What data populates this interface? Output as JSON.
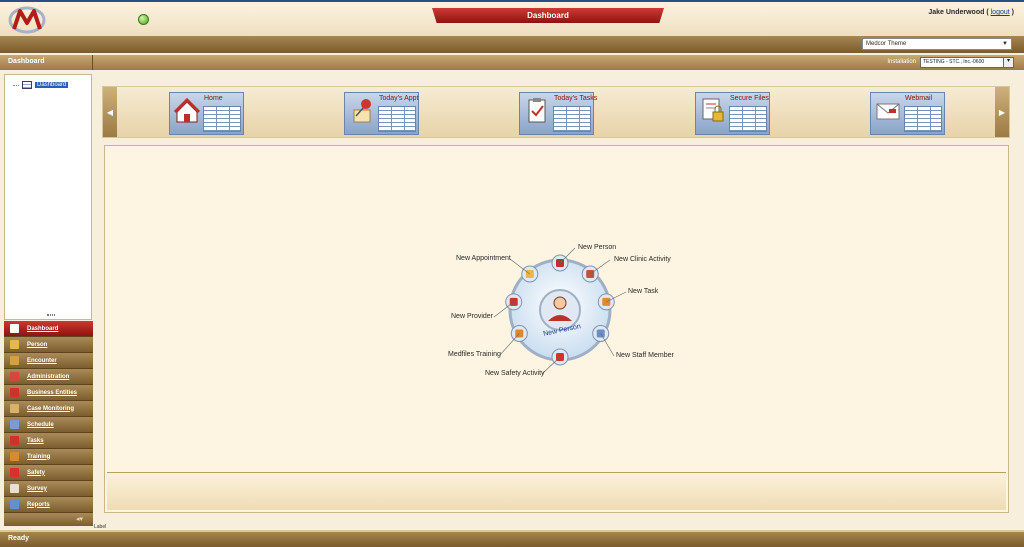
{
  "header": {
    "title": "Dashboard",
    "user_name": "Jake Underwood",
    "logout_prefix": "(",
    "logout_label": "logout",
    "logout_suffix": ")"
  },
  "theme": {
    "selected": "Medcor Theme"
  },
  "section": {
    "title": "Dashboard",
    "installation_label": "Installation",
    "installation_value": "TESTING - STC., Inc.-0600"
  },
  "tree": {
    "items": [
      {
        "label": "Dashboard"
      }
    ]
  },
  "nav": {
    "items": [
      {
        "label": "Dashboard",
        "active": true,
        "color": "#ffffff"
      },
      {
        "label": "Person",
        "color": "#e6b84a"
      },
      {
        "label": "Encounter",
        "color": "#d6a040"
      },
      {
        "label": "Administration",
        "color": "#c94c3c"
      },
      {
        "label": "Business Entities",
        "color": "#c0392b"
      },
      {
        "label": "Case Monitoring",
        "color": "#d9b26a"
      },
      {
        "label": "Schedule",
        "color": "#7f9cc9"
      },
      {
        "label": "Tasks",
        "color": "#c0392b"
      },
      {
        "label": "Training",
        "color": "#d88b2a"
      },
      {
        "label": "Safety",
        "color": "#d0342c"
      },
      {
        "label": "Survey",
        "color": "#e8e0d0"
      },
      {
        "label": "Reports",
        "color": "#6b8fc4"
      }
    ]
  },
  "footer_label": "Label",
  "status_text": "Ready",
  "tiles": [
    {
      "label": "Home",
      "icon": "home-icon"
    },
    {
      "label": "Today's Appt",
      "icon": "pushpin-icon"
    },
    {
      "label": "Today's Tasks",
      "icon": "clipboard-check-icon"
    },
    {
      "label": "Secure Files",
      "icon": "lock-file-icon"
    },
    {
      "label": "Webmail",
      "icon": "envelope-icon"
    }
  ],
  "radial": {
    "center_label": "New Person",
    "items": [
      {
        "label": "New Person"
      },
      {
        "label": "New Clinic Activity"
      },
      {
        "label": "New Task"
      },
      {
        "label": "New Staff Member"
      },
      {
        "label": "New Safety Activity"
      },
      {
        "label": "Medfiles Training"
      },
      {
        "label": "New Provider"
      },
      {
        "label": "New Appointment"
      }
    ]
  }
}
